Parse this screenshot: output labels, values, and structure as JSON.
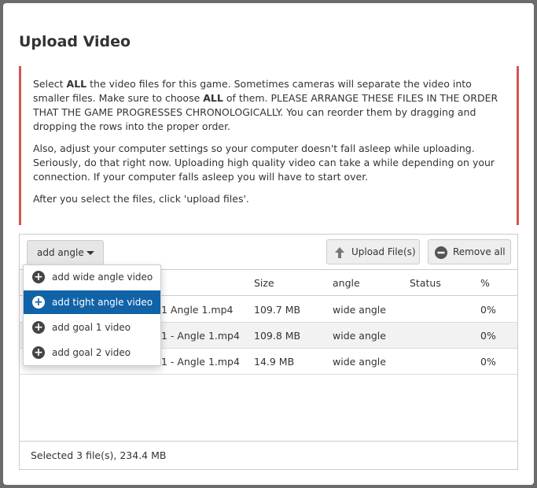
{
  "title": "Upload Video",
  "notice": {
    "p1_a": "Select ",
    "p1_b": "ALL",
    "p1_c": " the video files for this game. Sometimes cameras will separate the video into smaller files. Make sure to choose ",
    "p1_d": "ALL",
    "p1_e": " of them. PLEASE ARRANGE THESE FILES IN THE ORDER THAT THE GAME PROGRESSES CHRONOLOGICALLY. You can reorder them by dragging and dropping the rows into the proper order.",
    "p2": "Also, adjust your computer settings so your computer doesn't fall asleep while uploading. Seriously, do that right now. Uploading high quality video can take a while depending on your connection. If your computer falls asleep you will have to start over.",
    "p3": "After you select the files, click 'upload files'."
  },
  "toolbar": {
    "angle_label": "add angle",
    "upload_label": "Upload File(s)",
    "remove_label": "Remove all"
  },
  "table": {
    "headers": {
      "size": "Size",
      "angle": "angle",
      "status": "Status",
      "pct": "%"
    },
    "rows": [
      {
        "name": "1 Angle 1.mp4",
        "size": "109.7 MB",
        "angle": "wide angle",
        "status": "",
        "pct": "0%"
      },
      {
        "name": "1 - Angle 1.mp4",
        "size": "109.8 MB",
        "angle": "wide angle",
        "status": "",
        "pct": "0%"
      },
      {
        "name": "1 - Angle 1.mp4",
        "size": "14.9 MB",
        "angle": "wide angle",
        "status": "",
        "pct": "0%"
      }
    ]
  },
  "footer": {
    "summary": "Selected 3 file(s), 234.4 MB"
  },
  "menu": {
    "items": [
      {
        "label": "add wide angle video"
      },
      {
        "label": "add tight angle video"
      },
      {
        "label": "add goal 1 video"
      },
      {
        "label": "add goal 2 video"
      }
    ]
  },
  "colors": {
    "accent": "#d9534f",
    "menu_active": "#1163a8"
  }
}
